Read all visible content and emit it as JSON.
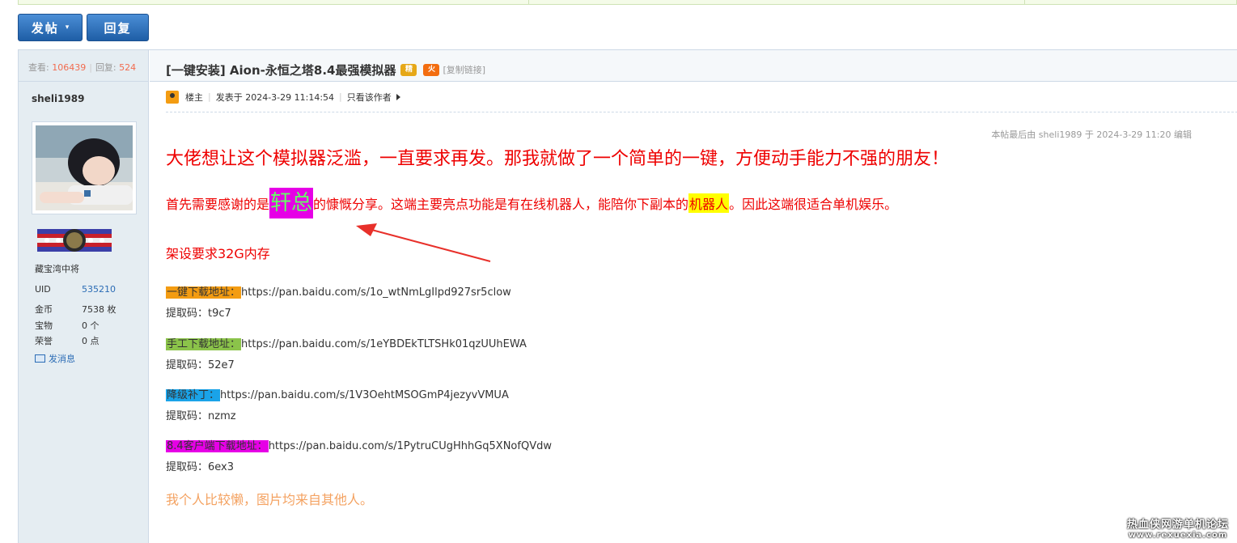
{
  "toolbar": {
    "post_label": "发帖",
    "post_caret": "▾",
    "reply_label": "回复"
  },
  "sidebar": {
    "views_label": "查看:",
    "views": "106439",
    "replies_label": "回复:",
    "replies": "524",
    "username": "sheli1989",
    "rank": "藏宝湾中将",
    "uid_label": "UID",
    "uid": "535210",
    "gold_label": "金币",
    "gold": "7538 枚",
    "treasure_label": "宝物",
    "treasure": "0 个",
    "honor_label": "荣誉",
    "honor": "0 点",
    "message_label": "发消息"
  },
  "thread": {
    "title": "[一键安装] Aion-永恒之塔8.4最强模拟器",
    "badge_jing": "精",
    "badge_huo": "火",
    "copy_link": "[复制链接]",
    "owner_label": "楼主",
    "posted": "发表于 2024-3-29 11:14:54",
    "only_author": "只看该作者",
    "edited": "本帖最后由 sheli1989 于 2024-3-29 11:20 编辑"
  },
  "content": {
    "headline": "大佬想让这个模拟器泛滥，一直要求再发。那我就做了一个简单的一键，方便动手能力不强的朋友！",
    "thanks_pre": "首先需要感谢的是",
    "thanks_name": "轩总",
    "thanks_mid": "的慷慨分享。这端主要亮点功能是有在线机器人，能陪你下副本的",
    "thanks_robot": "机器人",
    "thanks_post": "。因此这端很适合单机娱乐。",
    "requirement": "架设要求32G内存",
    "downloads": [
      {
        "label": "一键下载地址：",
        "url": "https://pan.baidu.com/s/1o_wtNmLgIlpd927sr5clow",
        "code": "提取码：t9c7"
      },
      {
        "label": "手工下载地址：",
        "url": "https://pan.baidu.com/s/1eYBDEkTLTSHk01qzUUhEWA",
        "code": "提取码：52e7"
      },
      {
        "label": "降级补丁：",
        "url": "https://pan.baidu.com/s/1V3OehtMSOGmP4jezyvVMUA",
        "code": "提取码：nzmz"
      },
      {
        "label": "8.4客户端下载地址：",
        "url": "https://pan.baidu.com/s/1PytruCUgHhhGq5XNofQVdw",
        "code": "提取码：6ex3"
      }
    ],
    "footer_note": "我个人比较懒，图片均来自其他人。"
  },
  "watermark": {
    "cn": "热血侠网游单机论坛",
    "en": "www.rexuexia.com"
  },
  "colors": {
    "accent": "#1e5ea6",
    "red_text": "#ee0000",
    "orange_text": "#f4a261",
    "magenta_highlight": "#e600e6",
    "yellow_highlight": "#ffff00"
  }
}
